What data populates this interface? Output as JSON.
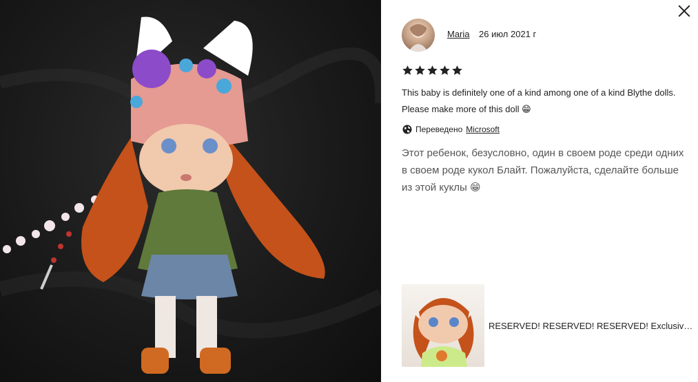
{
  "dialog": {
    "close_icon": "close-icon"
  },
  "review": {
    "reviewer_name": "Maria",
    "date": "26 июл 2021 г",
    "rating": 5,
    "rating_max": 5,
    "star_glyph": "★",
    "text_original": "This baby is definitely one of a kind among one of a kind Blythe dolls. Please make more of this doll 😁",
    "translated_label": "Переведено",
    "translator_link": "Microsoft",
    "text_translated": "Этот ребенок, безусловно, один в своем роде среди одних в своем роде кукол Блайт. Пожалуйста, сделайте больше из этой куклы 😁"
  },
  "listing": {
    "title": "RESERVED! RESERVED! RESERVED! Exclusive OOAK Blythe doll"
  },
  "colors": {
    "text": "#222222",
    "muted_text": "#555555",
    "photo_background": "#1a1a1a"
  }
}
